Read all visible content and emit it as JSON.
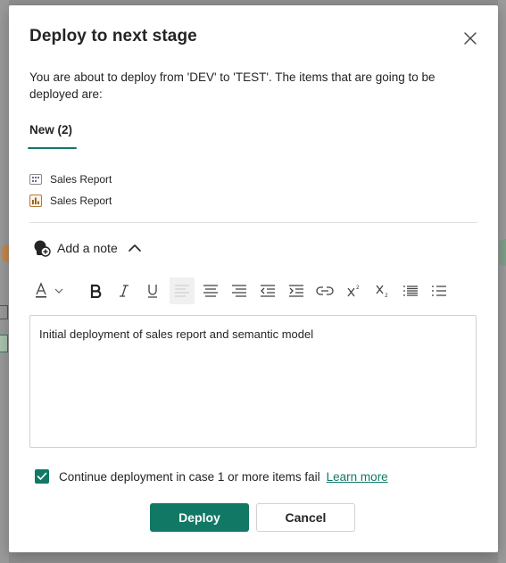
{
  "dialog": {
    "title": "Deploy to next stage",
    "description": "You are about to deploy from 'DEV' to 'TEST'. The items that are going to be deployed are:",
    "close_icon": "close-icon"
  },
  "tabs": [
    {
      "label": "New (2)",
      "selected": true
    }
  ],
  "items": [
    {
      "name": "Sales Report",
      "icon": "semantic-model-icon"
    },
    {
      "name": "Sales Report",
      "icon": "report-icon"
    }
  ],
  "note": {
    "toggle_label": "Add a note",
    "expanded": true,
    "text": "Initial deployment of sales report and semantic model"
  },
  "toolbar": {
    "buttons": [
      "font-color-icon",
      "dropdown-chevron-icon",
      "bold-icon",
      "italic-icon",
      "underline-icon",
      "align-left-icon",
      "align-center-icon",
      "align-right-icon",
      "outdent-icon",
      "indent-icon",
      "link-icon",
      "superscript-icon",
      "subscript-icon",
      "bulleted-list-icon",
      "numbered-list-icon"
    ]
  },
  "options": {
    "continue_label": "Continue deployment in case 1 or more items fail",
    "continue_checked": true,
    "learn_more": "Learn more"
  },
  "actions": {
    "deploy": "Deploy",
    "cancel": "Cancel"
  },
  "colors": {
    "accent": "#117865",
    "text": "#242424",
    "border": "#d1d1d1"
  }
}
